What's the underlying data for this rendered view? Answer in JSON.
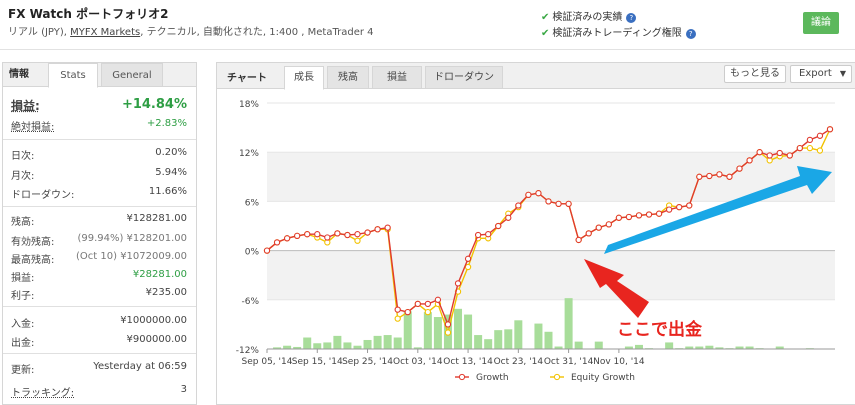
{
  "header": {
    "title": "FX Watch ポートフォリオ2",
    "subtitle_prefix": "リアル (JPY), ",
    "broker_link": "MYFX Markets",
    "subtitle_suffix": ", テクニカル, 自動化された, 1:400 , MetaTrader 4",
    "verified_track": "検証済みの実績",
    "verified_trading": "検証済みトレーディング権限",
    "discuss_button": "議論"
  },
  "left": {
    "tab_label": "情報",
    "tab_stats": "Stats",
    "tab_general": "General",
    "rows": [
      {
        "k": "損益:",
        "v": "+14.84%"
      },
      {
        "k": "絶対損益:",
        "v": "+2.83%"
      },
      {
        "k": "日次:",
        "v": "0.20%"
      },
      {
        "k": "月次:",
        "v": "5.94%"
      },
      {
        "k": "ドローダウン:",
        "v": "11.66%"
      },
      {
        "k": "残高:",
        "v": "¥128281.00"
      },
      {
        "k": "有効残高:",
        "v": "(99.94%) ¥128201.00"
      },
      {
        "k": "最高残高:",
        "v": "(Oct 10) ¥1072009.00"
      },
      {
        "k": "損益:",
        "v": "¥28281.00"
      },
      {
        "k": "利子:",
        "v": "¥235.00"
      },
      {
        "k": "入金:",
        "v": "¥1000000.00"
      },
      {
        "k": "出金:",
        "v": "¥900000.00"
      },
      {
        "k": "更新:",
        "v": "Yesterday at 06:59"
      },
      {
        "k": "トラッキング:",
        "v": "3"
      }
    ]
  },
  "chart_panel": {
    "label": "チャート",
    "tabs": [
      "成長",
      "残高",
      "損益",
      "ドローダウン"
    ],
    "more_button": "もっと見る",
    "export_button": "Export"
  },
  "annotation": "ここで出金",
  "colors": {
    "growth": "#e03a2f",
    "equity": "#f2c200",
    "bars": "#a8dd9a",
    "profit": "#2e9e44",
    "arrow_red": "#e8251f",
    "arrow_blue": "#1aa7e6"
  },
  "chart_data": {
    "type": "line",
    "y_ticks": [
      "18%",
      "12%",
      "6%",
      "0%",
      "-6%",
      "-12%"
    ],
    "ylim": [
      -12,
      18
    ],
    "x_tick_labels": [
      "Sep 05, '14",
      "Sep 15, '14",
      "Sep 25, '14",
      "Oct 03, '14",
      "Oct 13, '14",
      "Oct 23, '14",
      "Oct 31, '14",
      "Nov 10, '14"
    ],
    "x_ticks_at": [
      0,
      5,
      10,
      15,
      20,
      25,
      30,
      35
    ],
    "series": [
      {
        "name": "Growth",
        "values": [
          0,
          1,
          1.5,
          1.8,
          2,
          2,
          1.6,
          2.1,
          1.9,
          2,
          2.2,
          2.6,
          2.8,
          -7.2,
          -7.5,
          -6.5,
          -6.5,
          -6,
          -9,
          -4,
          -1,
          1.9,
          2,
          3,
          4,
          5.5,
          6.8,
          7,
          6,
          5.7,
          5.7,
          1.3,
          2.1,
          2.8,
          3.2,
          4,
          4.1,
          4.3,
          4.4,
          4.5,
          5,
          5.3,
          5.5,
          9,
          9.1,
          9.3,
          9,
          10,
          11,
          12,
          11.6,
          11.9,
          11.6,
          12.5,
          13.5,
          14,
          14.8
        ]
      },
      {
        "name": "Equity Growth",
        "values": [
          0,
          1,
          1.5,
          1.8,
          2,
          1.6,
          1,
          2.1,
          1.9,
          1.2,
          2.2,
          2.6,
          2.6,
          -8.3,
          -7.5,
          -6.5,
          -7.5,
          -6.5,
          -10,
          -5,
          -2,
          1.5,
          1.5,
          3,
          4.5,
          5.3,
          6.8,
          7,
          6,
          5.7,
          5.7,
          1.3,
          2.1,
          2.8,
          3.2,
          4,
          4.1,
          4.3,
          4.4,
          4.5,
          5.5,
          5.3,
          5.5,
          9,
          9.1,
          9.3,
          9,
          10,
          11,
          12,
          11,
          11.5,
          11.6,
          12.5,
          12.5,
          12.2,
          14.8
        ]
      }
    ],
    "bars": [
      0,
      0.2,
      0.4,
      0.25,
      1.4,
      0.7,
      0.8,
      1.6,
      0.8,
      0.4,
      1.1,
      1.6,
      1.7,
      1.4,
      4.6,
      0.2,
      4.5,
      3.9,
      4.2,
      4.9,
      4.2,
      1.7,
      1.2,
      2.3,
      2.4,
      3.5,
      0,
      3.1,
      2.1,
      0.3,
      6.2,
      0.9,
      0,
      0.9,
      0,
      0,
      0.3,
      0.5,
      0.1,
      0,
      0.8,
      0.1,
      0.3,
      0.3,
      0.4,
      0.2,
      0.1,
      0.3,
      0.3,
      0.1,
      0,
      0.3,
      0,
      0,
      0.1,
      0,
      0.05
    ],
    "legend": [
      "Growth",
      "Equity Growth"
    ],
    "grid": true,
    "legend_position": "bottom"
  }
}
